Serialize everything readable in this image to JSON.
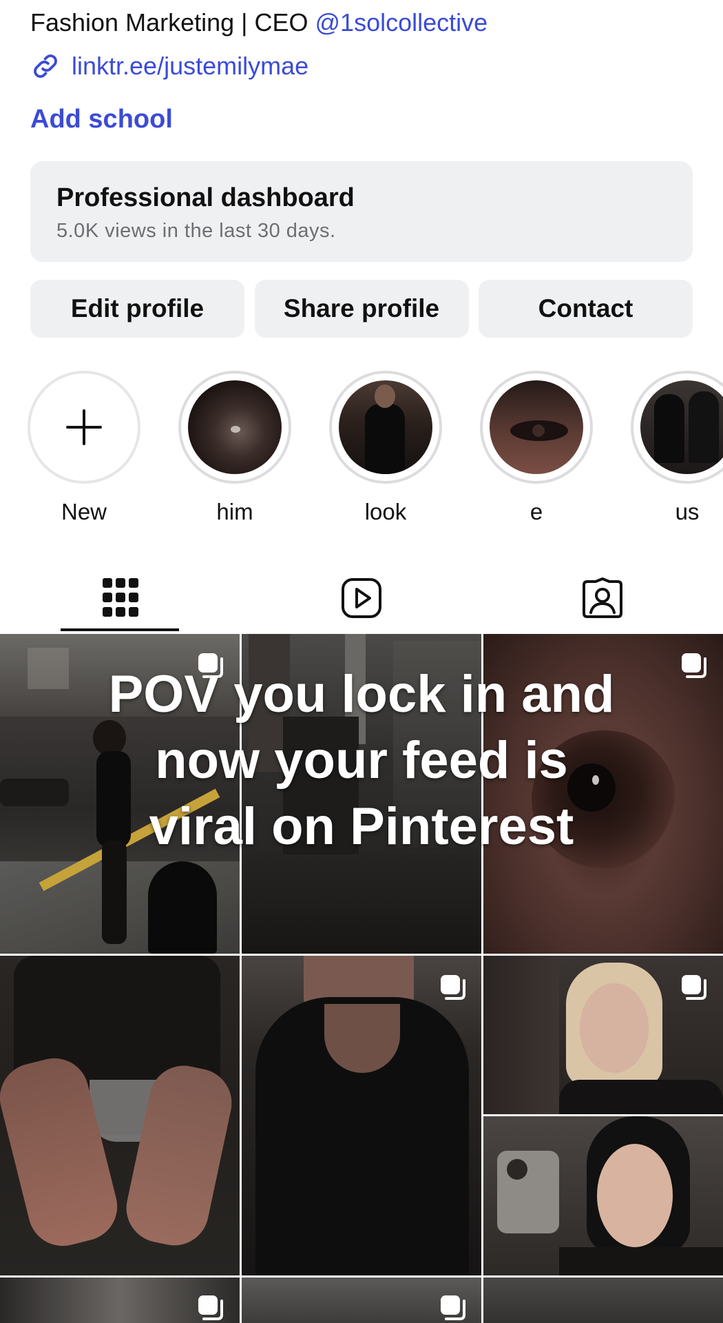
{
  "bio": {
    "text": "Fashion Marketing | CEO ",
    "handle": "@1solcollective",
    "link": "linktr.ee/justemilymae",
    "add_school": "Add school"
  },
  "dashboard": {
    "title": "Professional dashboard",
    "subtitle": "5.0K views in the last 30 days."
  },
  "buttons": {
    "edit": "Edit profile",
    "share": "Share profile",
    "contact": "Contact"
  },
  "highlights": [
    {
      "label": "New",
      "icon": "plus-icon"
    },
    {
      "label": "him"
    },
    {
      "label": "look"
    },
    {
      "label": "e"
    },
    {
      "label": "us"
    }
  ],
  "tabs": [
    {
      "name": "posts-grid",
      "icon": "grid-icon",
      "active": true
    },
    {
      "name": "reels",
      "icon": "reels-icon",
      "active": false
    },
    {
      "name": "tagged",
      "icon": "tagged-icon",
      "active": false
    }
  ],
  "post_overlay_text": [
    "POV you lock in and",
    "now your feed is",
    "viral on Pinterest"
  ],
  "colors": {
    "link": "#3b4bd6",
    "card_bg": "#eff0f2",
    "subtle_text": "#6e6e73"
  }
}
